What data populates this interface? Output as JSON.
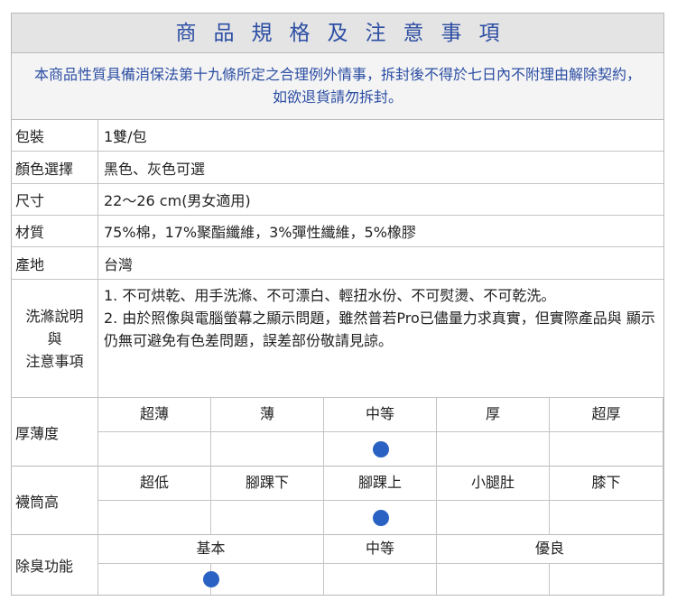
{
  "title": "商品規格及注意事項",
  "notice": "本商品性質具備消保法第十九條所定之合理例外情事，拆封後不得於七日內不附理由解除契約，如欲退貨請勿拆封。",
  "specs": [
    {
      "label": "包裝",
      "value": "1雙/包"
    },
    {
      "label": "顏色選擇",
      "value": "黑色、灰色可選"
    },
    {
      "label": "尺寸",
      "value": "22～26 cm(男女適用)"
    },
    {
      "label": "材質",
      "value": "75%棉，17%聚酯纖維，3%彈性纖維，5%橡膠"
    },
    {
      "label": "產地",
      "value": "台灣"
    }
  ],
  "wash": {
    "label_line1": "洗滌說明",
    "label_line2": "與",
    "label_line3": "注意事項",
    "item1": "1.  不可烘乾、用手洗滌、不可漂白、輕扭水份、不可熨燙、不可乾洗。",
    "item2": "2.  由於照像與電腦螢幕之顯示問題，雖然普若Pro已儘量力求真實，但實際產品與 顯示仍無可避免有色差問題，誤差部份敬請見諒。"
  },
  "thickness": {
    "label": "厚薄度",
    "options": [
      "超薄",
      "薄",
      "中等",
      "厚",
      "超厚"
    ],
    "selected": "中等"
  },
  "sock_height": {
    "label": "襪筒高",
    "options": [
      "超低",
      "腳踝下",
      "腳踝上",
      "小腿肚",
      "膝下"
    ],
    "selected": "腳踝上"
  },
  "deodorize": {
    "label": "除臭功能",
    "options": [
      "基本",
      "中等",
      "優良"
    ],
    "selected": "基本"
  },
  "colors": {
    "accent": "#2c4ea3",
    "dot": "#2a62c3",
    "title_bg": "#e4e4e4"
  }
}
